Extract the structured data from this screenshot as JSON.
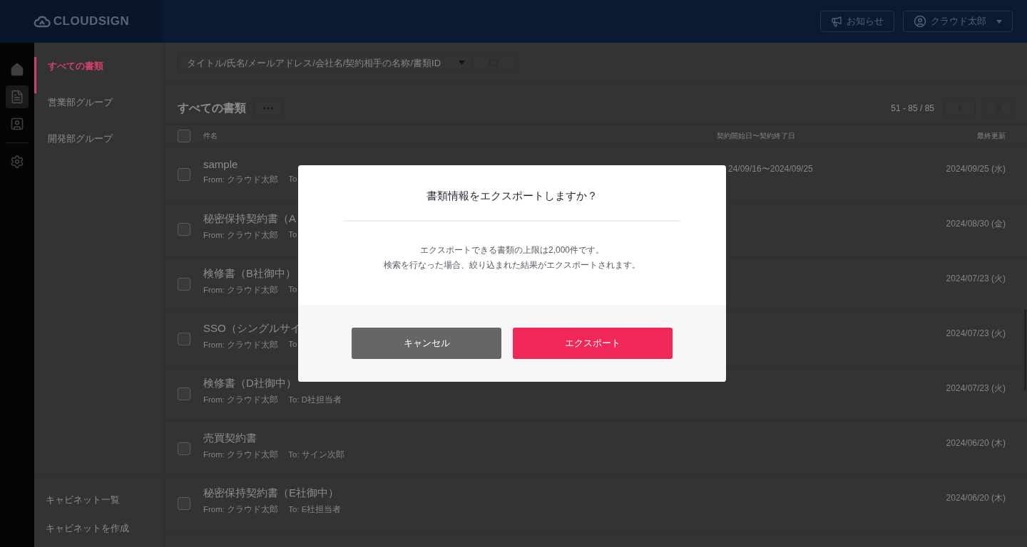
{
  "header": {
    "logo": "CLOUDSIGN",
    "notice_button": "お知らせ",
    "user_menu": "クラウド太郎"
  },
  "rail": [
    {
      "kind": "home",
      "selected": false
    },
    {
      "kind": "document",
      "selected": true
    },
    {
      "kind": "contact",
      "selected": false
    },
    {
      "kind": "settings",
      "selected": false
    }
  ],
  "sidebar": {
    "items": [
      {
        "label": "すべての書類",
        "selected": true
      },
      {
        "label": "営業部グループ",
        "selected": false
      },
      {
        "label": "開発部グループ",
        "selected": false
      }
    ],
    "footer_links": [
      "キャビネット一覧",
      "キャビネットを作成"
    ]
  },
  "search": {
    "placeholder": "タイトル/氏名/メールアドレス/会社名/契約相手の名称/書類ID"
  },
  "list": {
    "title": "すべての書類",
    "pagination": "51 - 85 / 85",
    "select_all_checked": false,
    "columns": [
      "件名",
      "契約開始日〜契約終了日",
      "最終更新"
    ],
    "rows": [
      {
        "title": "sample",
        "from": "From: クラウド太郎",
        "to": "To",
        "period": "24/09/16〜2024/09/25",
        "updated": "2024/09/25 (水)",
        "checked": false
      },
      {
        "title": "秘密保持契約書（A",
        "from": "From: クラウド太郎",
        "to": "To",
        "updated": "2024/08/30 (金)",
        "checked": false
      },
      {
        "title": "検修書（B社御中）",
        "from": "From: クラウド太郎",
        "to": "To",
        "updated": "2024/07/23 (火)",
        "checked": false
      },
      {
        "title": "SSO（シングルサイ",
        "from": "From: クラウド太郎",
        "to": "To",
        "updated": "2024/07/23 (火)",
        "checked": false
      },
      {
        "title": "検修書（D社御中）",
        "from": "From: クラウド太郎",
        "to": "To: D社担当者",
        "updated": "2024/07/23 (火)",
        "checked": false
      },
      {
        "title": "売買契約書",
        "from": "From: クラウド太郎",
        "to": "To: サイン次郎",
        "updated": "2024/06/20 (木)",
        "checked": false
      },
      {
        "title": "秘密保持契約書（E社御中）",
        "from": "From: クラウド太郎",
        "to": "To: E社担当者",
        "updated": "2024/06/20 (木)",
        "checked": false
      }
    ]
  },
  "modal": {
    "title": "書類情報をエクスポートしますか？",
    "message": [
      "エクスポートできる書類の上限は2,000件です。",
      "検索を行なった場合、絞り込まれた結果がエクスポートされます。"
    ],
    "buttons": [
      {
        "label": "キャンセル",
        "kind": "secondary"
      },
      {
        "label": "エクスポート",
        "kind": "primary"
      }
    ]
  }
}
